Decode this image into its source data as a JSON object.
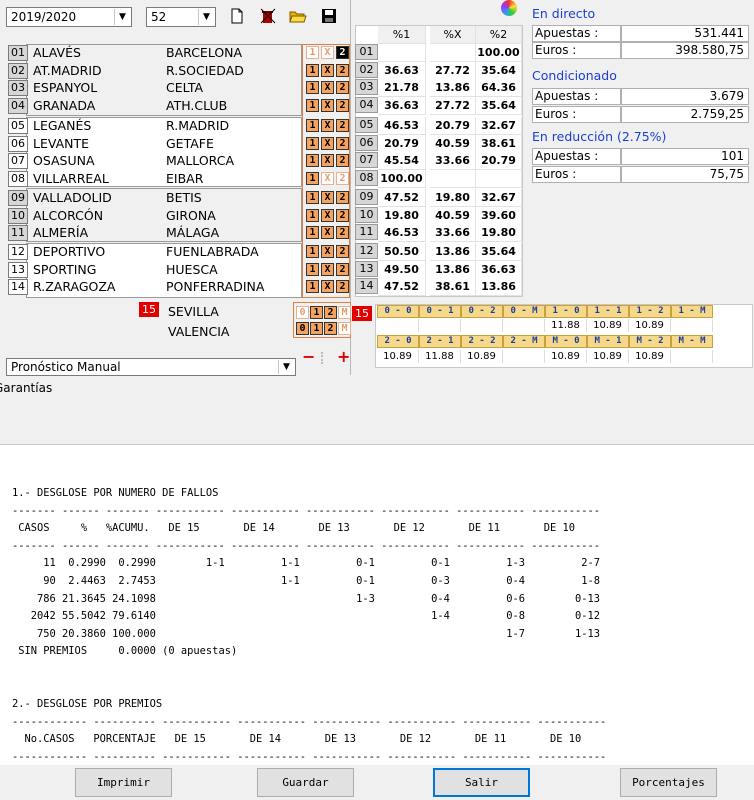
{
  "toolbar": {
    "season": "2019/2020",
    "jornada": "52",
    "icons": [
      "new-icon",
      "delete-icon",
      "open-folder-icon",
      "save-icon"
    ]
  },
  "matches": [
    {
      "n": "01",
      "home": "ALAVÉS",
      "away": "BARCELONA",
      "sel": [
        "off",
        "off",
        "on2"
      ]
    },
    {
      "n": "02",
      "home": "AT.MADRID",
      "away": "R.SOCIEDAD",
      "sel": [
        "on",
        "on",
        "on"
      ]
    },
    {
      "n": "03",
      "home": "ESPANYOL",
      "away": "CELTA",
      "sel": [
        "on",
        "on",
        "on"
      ]
    },
    {
      "n": "04",
      "home": "GRANADA",
      "away": "ATH.CLUB",
      "sel": [
        "on",
        "on",
        "on"
      ]
    },
    {
      "n": "05",
      "home": "LEGANÉS",
      "away": "R.MADRID",
      "sel": [
        "on",
        "on",
        "on"
      ]
    },
    {
      "n": "06",
      "home": "LEVANTE",
      "away": "GETAFE",
      "sel": [
        "on",
        "on",
        "on"
      ]
    },
    {
      "n": "07",
      "home": "OSASUNA",
      "away": "MALLORCA",
      "sel": [
        "on",
        "on",
        "on"
      ]
    },
    {
      "n": "08",
      "home": "VILLARREAL",
      "away": "EIBAR",
      "sel": [
        "on",
        "off",
        "off"
      ]
    },
    {
      "n": "09",
      "home": "VALLADOLID",
      "away": "BETIS",
      "sel": [
        "on",
        "on",
        "on"
      ]
    },
    {
      "n": "10",
      "home": "ALCORCÓN",
      "away": "GIRONA",
      "sel": [
        "on",
        "on",
        "on"
      ]
    },
    {
      "n": "11",
      "home": "ALMERÍA",
      "away": "MÁLAGA",
      "sel": [
        "on",
        "on",
        "on"
      ]
    },
    {
      "n": "12",
      "home": "DEPORTIVO",
      "away": "FUENLABRADA",
      "sel": [
        "on",
        "on",
        "on"
      ]
    },
    {
      "n": "13",
      "home": "SPORTING",
      "away": "HUESCA",
      "sel": [
        "on",
        "on",
        "on"
      ]
    },
    {
      "n": "14",
      "home": "R.ZARAGOZA",
      "away": "PONFERRADINA",
      "sel": [
        "on",
        "on",
        "on"
      ]
    }
  ],
  "pleno": {
    "n": "15",
    "home": "SEVILLA",
    "away": "VALENCIA",
    "row1": [
      "0",
      "1",
      "2",
      "M"
    ],
    "row2": [
      "0",
      "1",
      "2",
      "M"
    ]
  },
  "pct_table": {
    "headers": [
      "%1",
      "%X",
      "%2"
    ],
    "rows": [
      {
        "n": "01",
        "v": [
          "",
          "",
          "100.00"
        ]
      },
      {
        "n": "02",
        "v": [
          "36.63",
          "27.72",
          "35.64"
        ]
      },
      {
        "n": "03",
        "v": [
          "21.78",
          "13.86",
          "64.36"
        ]
      },
      {
        "n": "04",
        "v": [
          "36.63",
          "27.72",
          "35.64"
        ]
      },
      {
        "n": "05",
        "v": [
          "46.53",
          "20.79",
          "32.67"
        ]
      },
      {
        "n": "06",
        "v": [
          "20.79",
          "40.59",
          "38.61"
        ]
      },
      {
        "n": "07",
        "v": [
          "45.54",
          "33.66",
          "20.79"
        ]
      },
      {
        "n": "08",
        "v": [
          "100.00",
          "",
          ""
        ]
      },
      {
        "n": "09",
        "v": [
          "47.52",
          "19.80",
          "32.67"
        ]
      },
      {
        "n": "10",
        "v": [
          "19.80",
          "40.59",
          "39.60"
        ]
      },
      {
        "n": "11",
        "v": [
          "46.53",
          "33.66",
          "19.80"
        ]
      },
      {
        "n": "12",
        "v": [
          "50.50",
          "13.86",
          "35.64"
        ]
      },
      {
        "n": "13",
        "v": [
          "49.50",
          "13.86",
          "36.63"
        ]
      },
      {
        "n": "14",
        "v": [
          "47.52",
          "38.61",
          "13.86"
        ]
      }
    ]
  },
  "goals": {
    "n": "15",
    "h1": [
      "0 - 0",
      "0 - 1",
      "0 - 2",
      "0 - M",
      "1 - 0",
      "1 - 1",
      "1 - 2",
      "1 - M"
    ],
    "v1": [
      "",
      "",
      "",
      "",
      "11.88",
      "10.89",
      "10.89",
      ""
    ],
    "h2": [
      "2 - 0",
      "2 - 1",
      "2 - 2",
      "2 - M",
      "M - 0",
      "M - 1",
      "M - 2",
      "M - M"
    ],
    "v2": [
      "10.89",
      "11.88",
      "10.89",
      "",
      "10.89",
      "10.89",
      "10.89",
      ""
    ]
  },
  "right": {
    "directo": {
      "title": "En directo",
      "apuestas_label": "Apuestas :",
      "apuestas": "531.441",
      "euros_label": "Euros :",
      "euros": "398.580,75"
    },
    "condicionado": {
      "title": "Condicionado",
      "apuestas_label": "Apuestas :",
      "apuestas": "3.679",
      "euros_label": "Euros :",
      "euros": "2.759,25"
    },
    "reduccion": {
      "title": "En reducción (2.75%)",
      "apuestas_label": "Apuestas :",
      "apuestas": "101",
      "euros_label": "Euros :",
      "euros": "75,75"
    }
  },
  "pronostico": {
    "value": "Pronóstico Manual",
    "minus": "−",
    "plus": "+"
  },
  "garantias_title": "Garantías",
  "report_text": "1.- DESGLOSE POR NUMERO DE FALLOS\n------- ------ ------- ----------- ----------- ----------- ----------- ----------- -----------\n CASOS     %   %ACUMU.   DE 15       DE 14       DE 13       DE 12       DE 11       DE 10\n------- ------ ------- ----------- ----------- ----------- ----------- ----------- -----------\n     11  0.2990  0.2990        1-1         1-1         0-1         0-1         1-3         2-7\n     90  2.4463  2.7453                    1-1         0-1         0-3         0-4         1-8\n    786 21.3645 24.1098                                1-3         0-4         0-6        0-13\n   2042 55.5042 79.6140                                            1-4         0-8        0-12\n    750 20.3860 100.000                                                        1-7        1-13\n SIN PREMIOS     0.0000 (0 apuestas)\n\n\n2.- DESGLOSE POR PREMIOS\n------------ ---------- ----------- ----------- ----------- ----------- ----------- -----------\n  No.CASOS   PORCENTAJE   DE 15       DE 14       DE 13       DE 12       DE 11       DE 10\n------------ ---------- ----------- ----------- ----------- ----------- ----------- -----------",
  "buttons": {
    "imprimir": "Imprimir",
    "guardar": "Guardar",
    "salir": "Salir",
    "porcentajes": "Porcentajes"
  }
}
